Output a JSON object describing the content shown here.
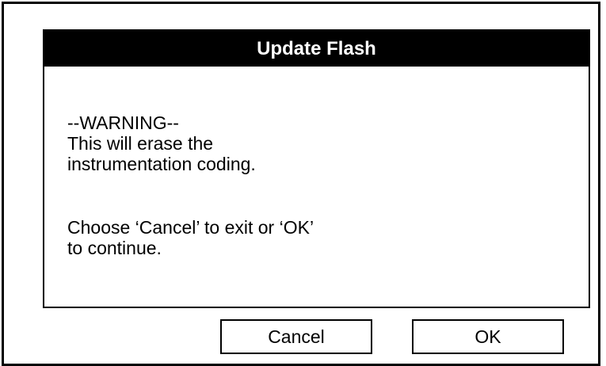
{
  "dialog": {
    "title": "Update Flash",
    "warning_heading": "--WARNING--",
    "warning_line1": "This will erase the",
    "warning_line2": "instrumentation coding.",
    "instruction_line1": "Choose ‘Cancel’ to exit or ‘OK’",
    "instruction_line2": "to continue."
  },
  "buttons": {
    "cancel_label": "Cancel",
    "ok_label": "OK"
  }
}
